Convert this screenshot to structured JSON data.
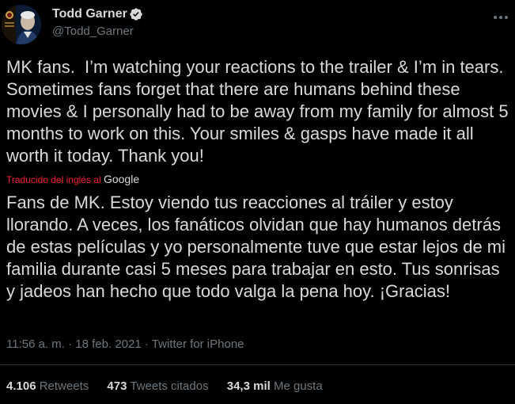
{
  "author": {
    "display_name": "Todd Garner",
    "handle": "@Todd_Garner",
    "verified": true,
    "avatar": "profile-photo"
  },
  "tweet": {
    "text": "MK fans.  I’m watching your reactions to the trailer & I’m in tears. Sometimes fans forget that there are humans behind these  movies & I personally had to be away from my family for almost 5 months to work on this. Your smiles & gasps have made it all worth it today. Thank you!",
    "translated_by_prefix": "Traducido del inglés al",
    "translated_by_service": "Google",
    "translated_text": "Fans de MK. Estoy viendo tus reacciones al tráiler y estoy llorando. A veces, los fanáticos olvidan que hay humanos detrás de estas películas y yo personalmente tuve que estar lejos de mi familia durante casi 5 meses para trabajar en esto. Tus sonrisas y jadeos han hecho que todo valga la pena hoy. ¡Gracias!",
    "time": "11:56 a. m.",
    "separator": "·",
    "date": "18 feb. 2021",
    "source": "Twitter for iPhone"
  },
  "stats": {
    "retweets_count": "4.106",
    "retweets_label": "Retweets",
    "quotes_count": "473",
    "quotes_label": "Tweets citados",
    "likes_count": "34,3 mil",
    "likes_label": "Me gusta"
  },
  "colors": {
    "background": "#000000",
    "text": "#d9d9d9",
    "secondary": "#6e767d",
    "translated_by": "#f4212e",
    "divider": "#2f3336"
  },
  "icons": {
    "verified": "verified-badge-icon",
    "more": "more-options-icon"
  }
}
